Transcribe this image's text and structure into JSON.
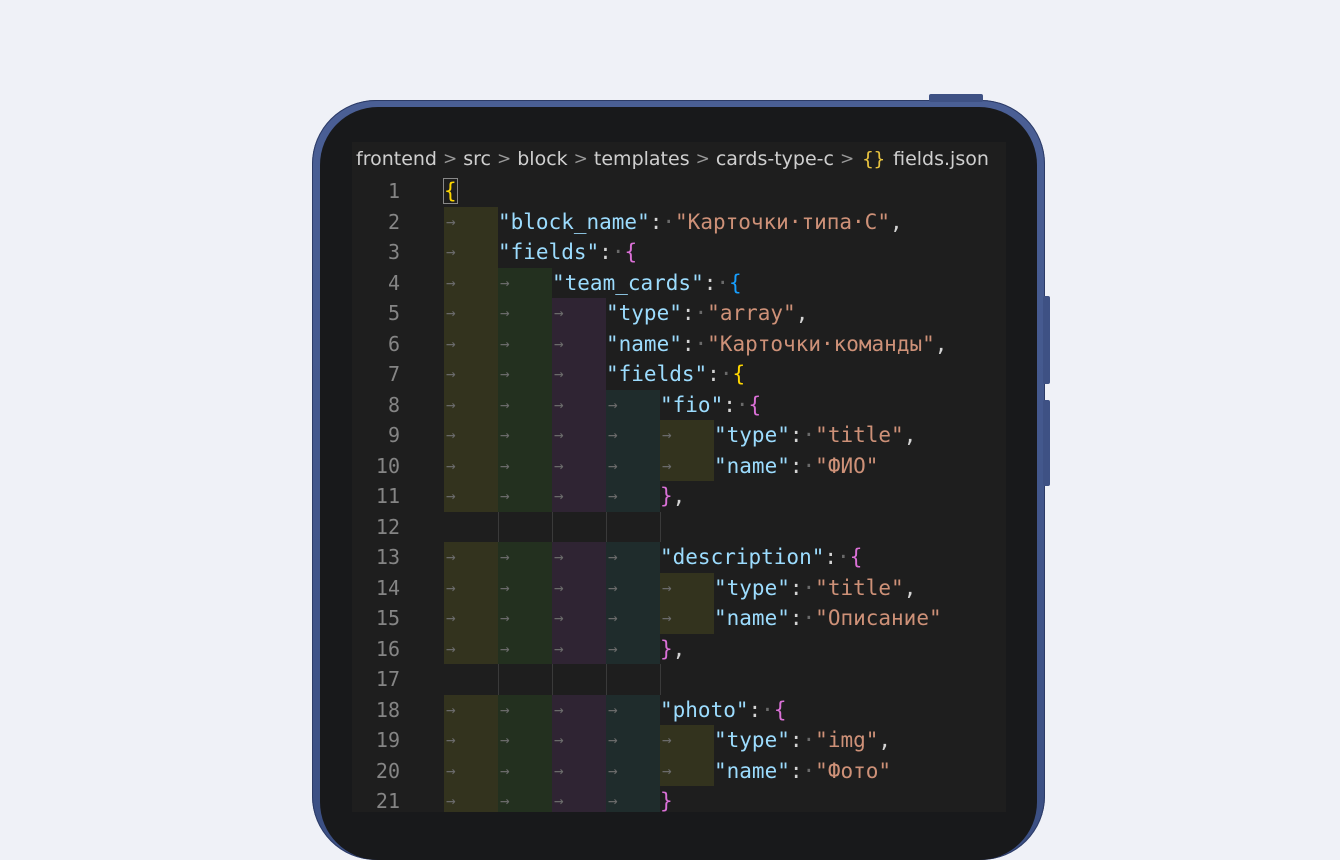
{
  "breadcrumb": {
    "items": [
      "frontend",
      "src",
      "block",
      "templates",
      "cards-type-c"
    ],
    "file_icon": "{}",
    "file_name": "fields.json"
  },
  "editor": {
    "lines": [
      {
        "n": "1",
        "indent": 0,
        "tokens": [
          [
            "b1",
            "{"
          ]
        ]
      },
      {
        "n": "2",
        "indent": 1,
        "tokens": [
          [
            "k",
            "\"block_name\""
          ],
          [
            "p",
            ":"
          ],
          [
            "dot",
            "·"
          ],
          [
            "s",
            "\"Карточки·типа·С\""
          ],
          [
            "p",
            ","
          ]
        ]
      },
      {
        "n": "3",
        "indent": 1,
        "tokens": [
          [
            "k",
            "\"fields\""
          ],
          [
            "p",
            ":"
          ],
          [
            "dot",
            "·"
          ],
          [
            "b2",
            "{"
          ]
        ]
      },
      {
        "n": "4",
        "indent": 2,
        "tokens": [
          [
            "k",
            "\"team_cards\""
          ],
          [
            "p",
            ":"
          ],
          [
            "dot",
            "·"
          ],
          [
            "b3",
            "{"
          ]
        ]
      },
      {
        "n": "5",
        "indent": 3,
        "tokens": [
          [
            "k",
            "\"type\""
          ],
          [
            "p",
            ":"
          ],
          [
            "dot",
            "·"
          ],
          [
            "s",
            "\"array\""
          ],
          [
            "p",
            ","
          ]
        ]
      },
      {
        "n": "6",
        "indent": 3,
        "tokens": [
          [
            "k",
            "\"name\""
          ],
          [
            "p",
            ":"
          ],
          [
            "dot",
            "·"
          ],
          [
            "s",
            "\"Карточки·команды\""
          ],
          [
            "p",
            ","
          ]
        ]
      },
      {
        "n": "7",
        "indent": 3,
        "tokens": [
          [
            "k",
            "\"fields\""
          ],
          [
            "p",
            ":"
          ],
          [
            "dot",
            "·"
          ],
          [
            "b1",
            "{"
          ]
        ]
      },
      {
        "n": "8",
        "indent": 4,
        "tokens": [
          [
            "k",
            "\"fio\""
          ],
          [
            "p",
            ":"
          ],
          [
            "dot",
            "·"
          ],
          [
            "b2",
            "{"
          ]
        ]
      },
      {
        "n": "9",
        "indent": 5,
        "tokens": [
          [
            "k",
            "\"type\""
          ],
          [
            "p",
            ":"
          ],
          [
            "dot",
            "·"
          ],
          [
            "s",
            "\"title\""
          ],
          [
            "p",
            ","
          ]
        ]
      },
      {
        "n": "10",
        "indent": 5,
        "tokens": [
          [
            "k",
            "\"name\""
          ],
          [
            "p",
            ":"
          ],
          [
            "dot",
            "·"
          ],
          [
            "s",
            "\"ФИО\""
          ]
        ]
      },
      {
        "n": "11",
        "indent": 4,
        "tokens": [
          [
            "b2",
            "}"
          ],
          [
            "p",
            ","
          ]
        ]
      },
      {
        "n": "12",
        "indent": 0,
        "tokens": []
      },
      {
        "n": "13",
        "indent": 4,
        "tokens": [
          [
            "k",
            "\"description\""
          ],
          [
            "p",
            ":"
          ],
          [
            "dot",
            "·"
          ],
          [
            "b2",
            "{"
          ]
        ]
      },
      {
        "n": "14",
        "indent": 5,
        "tokens": [
          [
            "k",
            "\"type\""
          ],
          [
            "p",
            ":"
          ],
          [
            "dot",
            "·"
          ],
          [
            "s",
            "\"title\""
          ],
          [
            "p",
            ","
          ]
        ]
      },
      {
        "n": "15",
        "indent": 5,
        "tokens": [
          [
            "k",
            "\"name\""
          ],
          [
            "p",
            ":"
          ],
          [
            "dot",
            "·"
          ],
          [
            "s",
            "\"Описание\""
          ]
        ]
      },
      {
        "n": "16",
        "indent": 4,
        "tokens": [
          [
            "b2",
            "}"
          ],
          [
            "p",
            ","
          ]
        ]
      },
      {
        "n": "17",
        "indent": 0,
        "tokens": []
      },
      {
        "n": "18",
        "indent": 4,
        "tokens": [
          [
            "k",
            "\"photo\""
          ],
          [
            "p",
            ":"
          ],
          [
            "dot",
            "·"
          ],
          [
            "b2",
            "{"
          ]
        ]
      },
      {
        "n": "19",
        "indent": 5,
        "tokens": [
          [
            "k",
            "\"type\""
          ],
          [
            "p",
            ":"
          ],
          [
            "dot",
            "·"
          ],
          [
            "s",
            "\"img\""
          ],
          [
            "p",
            ","
          ]
        ]
      },
      {
        "n": "20",
        "indent": 5,
        "tokens": [
          [
            "k",
            "\"name\""
          ],
          [
            "p",
            ":"
          ],
          [
            "dot",
            "·"
          ],
          [
            "s",
            "\"Фото\""
          ]
        ]
      },
      {
        "n": "21",
        "indent": 4,
        "tokens": [
          [
            "b2",
            "}"
          ]
        ]
      }
    ]
  },
  "colors": {
    "background": "#eff1f7",
    "phone_frame": "#3e5184",
    "editor_bg": "#1e1e1e",
    "key": "#9cdcfe",
    "string": "#ce9178",
    "bracket_gold": "#ffd700",
    "bracket_purple": "#da70d6",
    "bracket_blue": "#179fff"
  }
}
